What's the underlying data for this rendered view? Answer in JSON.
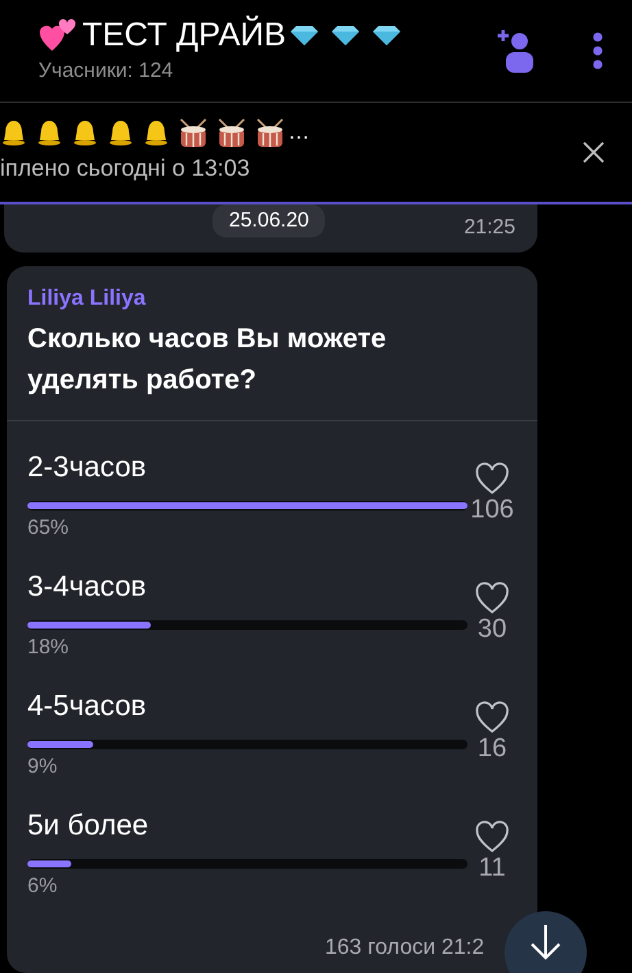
{
  "header": {
    "title": "ТЕСТ ДРАЙВ",
    "subtitle": "Учасники: 124"
  },
  "pinned": {
    "preview_suffix": "…",
    "caption": "іплено сьогодні о 13:03"
  },
  "previous_message": {
    "date": "25.06.20",
    "time": "21:25"
  },
  "poll": {
    "author": "Liliya Liliya",
    "question": "Сколько часов Вы можете уделять работе?",
    "options": [
      {
        "label": "2-3часов",
        "percent": "65%",
        "level": 1.0,
        "count": "106"
      },
      {
        "label": "3-4часов",
        "percent": "18%",
        "level": 0.28,
        "count": "30"
      },
      {
        "label": "4-5часов",
        "percent": "9%",
        "level": 0.15,
        "count": "16"
      },
      {
        "label": "5и более",
        "percent": "6%",
        "level": 0.1,
        "count": "11"
      }
    ],
    "votes": "163 голоси",
    "time": "21:2"
  }
}
